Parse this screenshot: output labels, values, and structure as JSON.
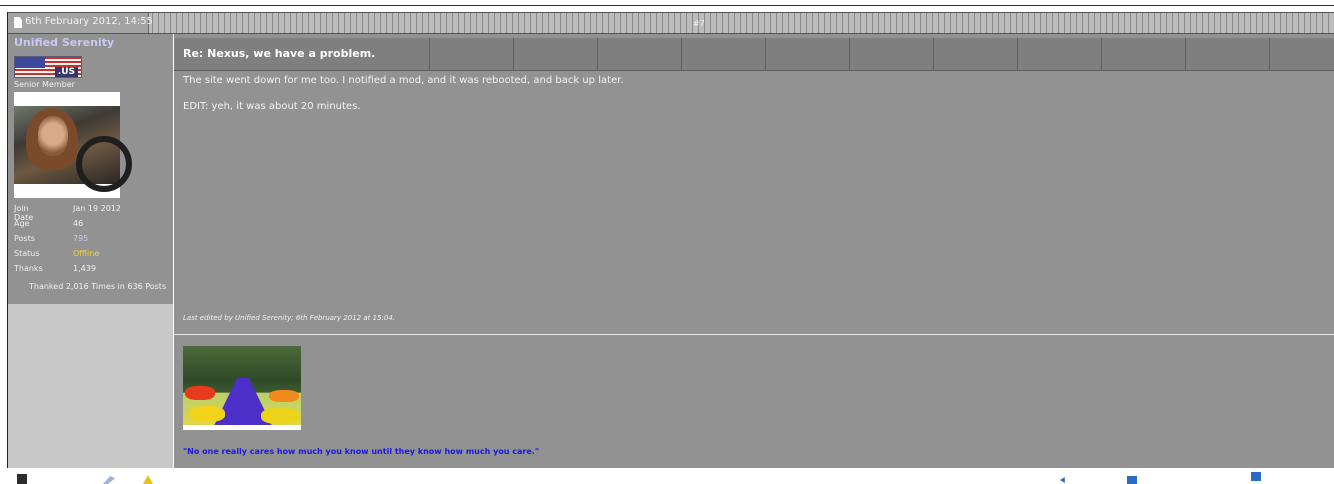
{
  "post": {
    "date": "6th February 2012, 14:55",
    "number": "#7"
  },
  "user": {
    "name": "Unified Serenity",
    "flag_tld": ".US",
    "title": "Senior Member",
    "stats": [
      {
        "key": "Join Date",
        "value": "Jan 19 2012"
      },
      {
        "key": "Age",
        "value": "46"
      },
      {
        "key": "Posts",
        "value": "795"
      },
      {
        "key": "Status",
        "value": "Offline"
      },
      {
        "key": "Thanks",
        "value": "1,439"
      }
    ],
    "thanked": "Thanked 2,016 Times in 636 Posts"
  },
  "message": {
    "title": "Re: Nexus, we have a problem.",
    "paragraphs": [
      "The site went down for me too. I notified a mod, and it was rebooted, and back up later.",
      "EDIT: yeh, it was about 20 minutes."
    ],
    "edited": "Last edited by Unified Serenity; 6th February 2012 at 15:04."
  },
  "signature": {
    "quote": "\"No one really cares how much you know until they know how much you care.\""
  },
  "footer": {
    "icons": [
      "user-profile-icon",
      "edit-icon",
      "report-icon",
      "reply-icon",
      "multiquote-icon",
      "quote-icon"
    ]
  },
  "colors": {
    "username": "#c9c9f0",
    "status_offline": "#f5d33a",
    "signature_quote": "#1a1ae0",
    "content_bg": "#929292"
  }
}
